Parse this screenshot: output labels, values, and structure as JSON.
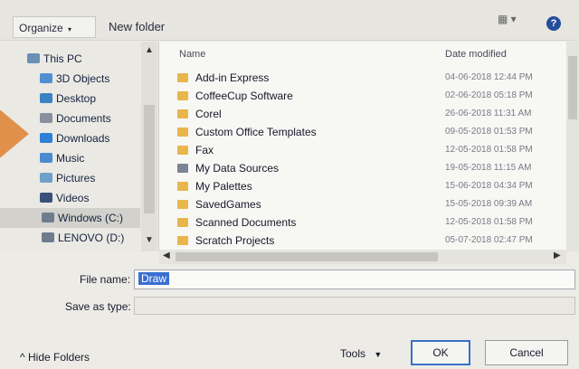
{
  "toolbar": {
    "organize_label": "Organize",
    "new_folder_label": "New folder",
    "view_icon": "view-options-icon",
    "help_icon": "help-icon"
  },
  "nav": {
    "items": [
      {
        "label": "This PC",
        "icon": "computer-icon",
        "color": "#6b8fb5"
      },
      {
        "label": "3D Objects",
        "icon": "cube-icon",
        "color": "#4f8fd1"
      },
      {
        "label": "Desktop",
        "icon": "desktop-icon",
        "color": "#3b82c4"
      },
      {
        "label": "Documents",
        "icon": "documents-icon",
        "color": "#8a8fa0"
      },
      {
        "label": "Downloads",
        "icon": "download-icon",
        "color": "#2e7fd6"
      },
      {
        "label": "Music",
        "icon": "music-icon",
        "color": "#4a8ad0"
      },
      {
        "label": "Pictures",
        "icon": "pictures-icon",
        "color": "#6fa0c8"
      },
      {
        "label": "Videos",
        "icon": "videos-icon",
        "color": "#3a4f7a"
      },
      {
        "label": "Windows (C:)",
        "icon": "drive-icon",
        "color": "#6e7c8e",
        "selected": true
      },
      {
        "label": "LENOVO (D:)",
        "icon": "drive-icon",
        "color": "#6e7c8e"
      }
    ]
  },
  "columns": {
    "name": "Name",
    "date_modified": "Date modified"
  },
  "files": [
    {
      "name": "Add-in Express",
      "date": "04-06-2018 12:44 PM"
    },
    {
      "name": "CoffeeCup Software",
      "date": "02-06-2018 05:18 PM"
    },
    {
      "name": "Corel",
      "date": "26-06-2018 11:31 AM"
    },
    {
      "name": "Custom Office Templates",
      "date": "09-05-2018 01:53 PM"
    },
    {
      "name": "Fax",
      "date": "12-05-2018 01:58 PM"
    },
    {
      "name": "My Data Sources",
      "date": "19-05-2018 11:15 AM"
    },
    {
      "name": "My Palettes",
      "date": "15-06-2018 04:34 PM"
    },
    {
      "name": "SavedGames",
      "date": "15-05-2018 09:39 AM"
    },
    {
      "name": "Scanned Documents",
      "date": "12-05-2018 01:58 PM"
    },
    {
      "name": "Scratch Projects",
      "date": "05-07-2018 02:47 PM"
    }
  ],
  "form": {
    "file_name_label": "File name:",
    "file_name_value": "Draw",
    "save_as_type_label": "Save as type:",
    "save_as_type_value": ""
  },
  "footer": {
    "hide_folders_label": "Hide Folders",
    "tools_label": "Tools",
    "ok_label": "OK",
    "cancel_label": "Cancel"
  }
}
